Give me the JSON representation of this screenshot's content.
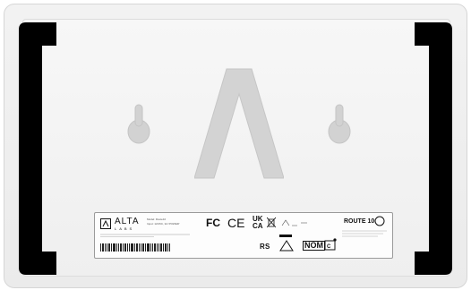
{
  "label": {
    "brand": "ALTA",
    "brand_sub": "LABS",
    "model_line": "Model: Route10",
    "power_line": "Input: 12VDC, 3A 'POWER'",
    "fcc_mark": "FC",
    "ce_mark": "CE",
    "ukca_top": "UK",
    "ukca_bottom": "CA",
    "product_name": "ROUTE 10",
    "nom_mark": "NOM"
  },
  "icons": [
    "alta-logo-icon",
    "fcc-icon",
    "ce-icon",
    "ukca-icon",
    "weee-bin-icon",
    "route10-emblem-icon",
    "compliance-mark-icon"
  ]
}
